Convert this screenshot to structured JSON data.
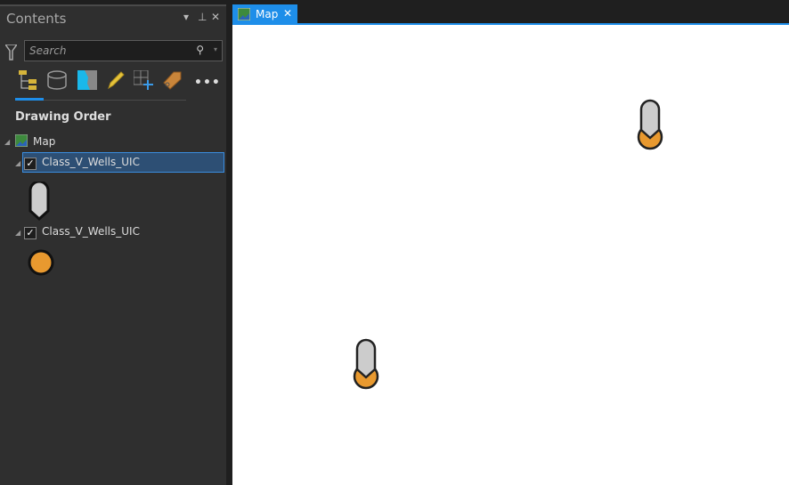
{
  "panel": {
    "title": "Contents",
    "search_placeholder": "Search",
    "heading": "Drawing Order",
    "map_label": "Map",
    "layers": [
      {
        "name": "Class_V_Wells_UIC",
        "checked": true,
        "symbol": "pin"
      },
      {
        "name": "Class_V_Wells_UIC",
        "checked": true,
        "symbol": "circle"
      }
    ]
  },
  "tab": {
    "label": "Map"
  },
  "colors": {
    "accent": "#1e8ee9",
    "point": "#e8992f",
    "pin": "#cccccc"
  }
}
